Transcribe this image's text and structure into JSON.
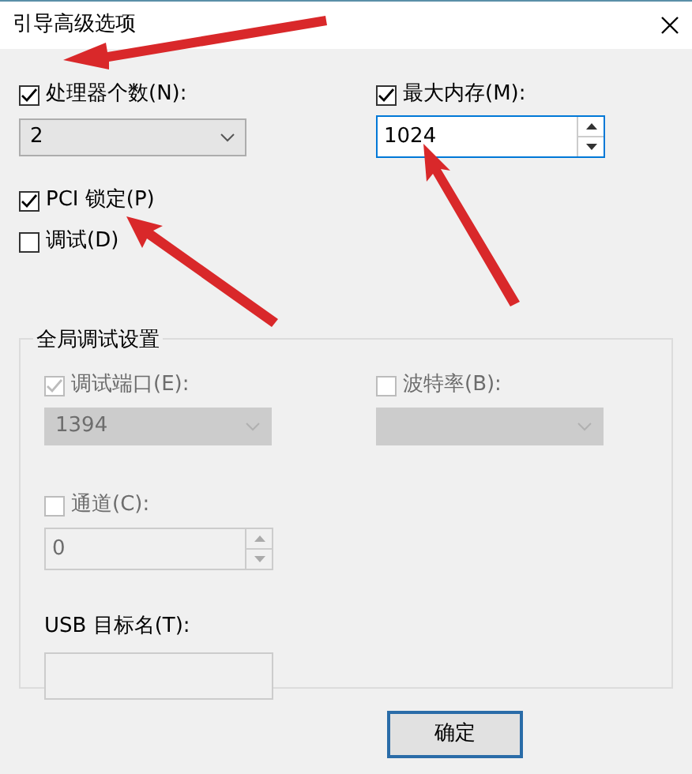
{
  "window": {
    "title": "引导高级选项"
  },
  "processors": {
    "label": "处理器个数(N):",
    "checked": true,
    "value": "2"
  },
  "max_memory": {
    "label": "最大内存(M):",
    "checked": true,
    "value": "1024"
  },
  "pci_lock": {
    "label": "PCI 锁定(P)",
    "checked": true
  },
  "debug": {
    "label": "调试(D)",
    "checked": false
  },
  "global_debug": {
    "title": "全局调试设置",
    "debug_port": {
      "label": "调试端口(E):",
      "checked": true,
      "disabled": true,
      "value": "1394"
    },
    "baud_rate": {
      "label": "波特率(B):",
      "checked": false,
      "disabled": true
    },
    "channel": {
      "label": "通道(C):",
      "checked": false,
      "disabled": true,
      "value": "0"
    },
    "usb_target": {
      "label": "USB 目标名(T):",
      "disabled": true
    }
  },
  "buttons": [
    {
      "label": "确定"
    }
  ]
}
